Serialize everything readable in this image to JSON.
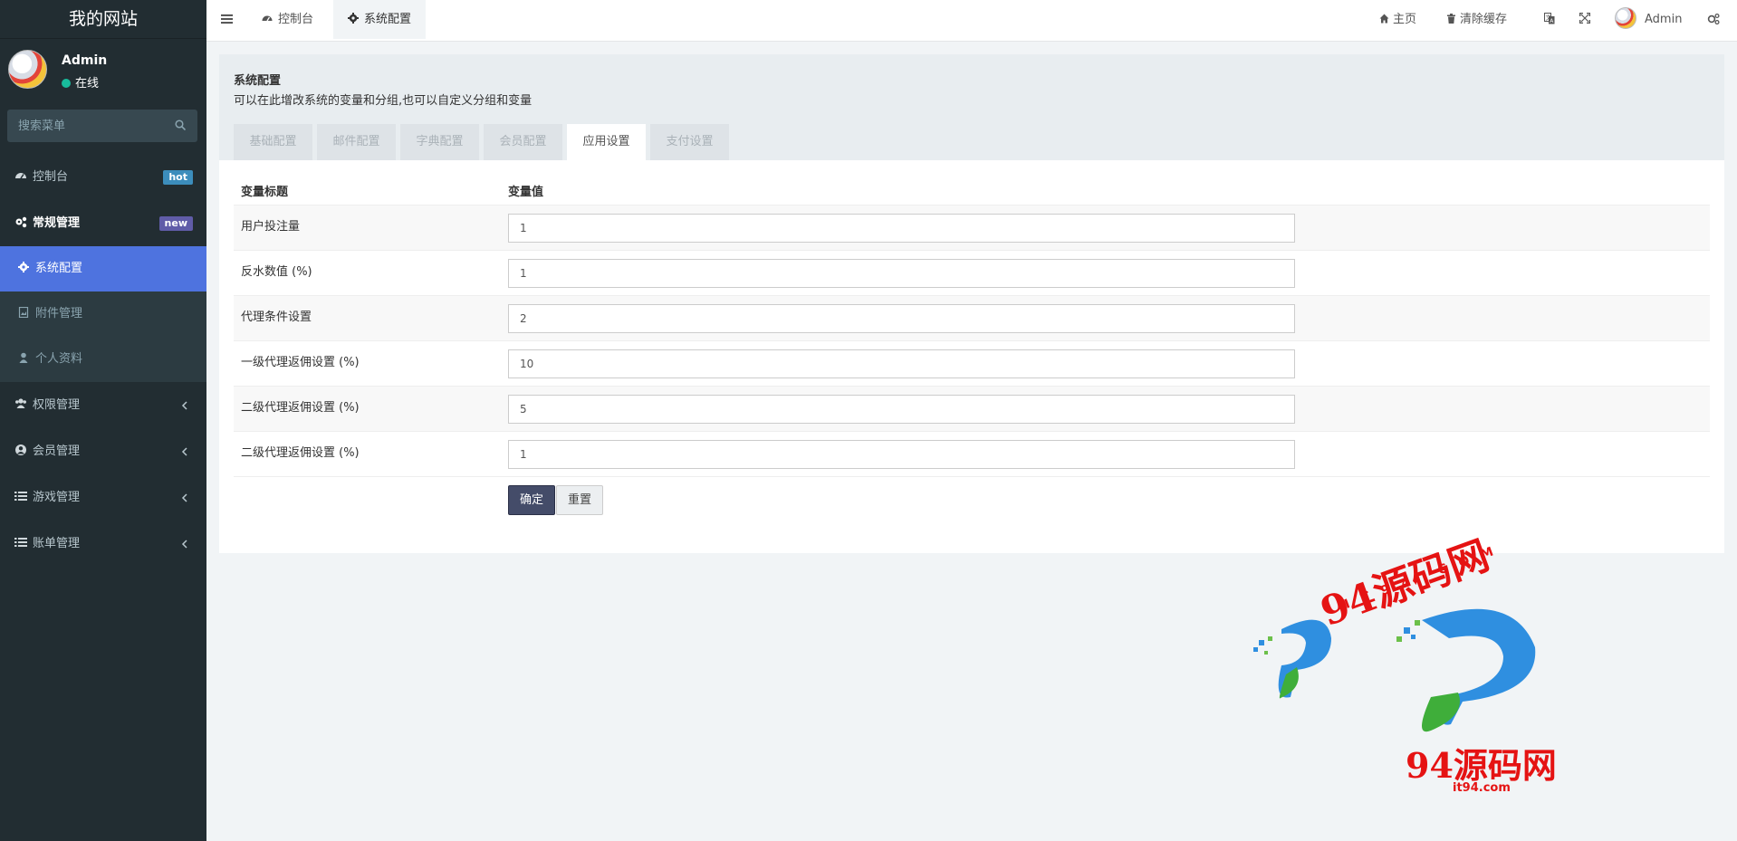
{
  "sidebar": {
    "site_title": "我的网站",
    "user": {
      "name": "Admin",
      "status": "在线"
    },
    "search_placeholder": "搜索菜单",
    "items": [
      {
        "label": "控制台",
        "badge": "hot"
      },
      {
        "label": "常规管理",
        "badge": "new"
      },
      {
        "label": "系统配置"
      },
      {
        "label": "附件管理"
      },
      {
        "label": "个人资料"
      },
      {
        "label": "权限管理"
      },
      {
        "label": "会员管理"
      },
      {
        "label": "游戏管理"
      },
      {
        "label": "账单管理"
      }
    ]
  },
  "topnav": {
    "tabs": [
      {
        "label": "控制台"
      },
      {
        "label": "系统配置"
      }
    ],
    "home": "主页",
    "clear_cache": "清除缓存",
    "user": "Admin"
  },
  "panel": {
    "title": "系统配置",
    "description": "可以在此增改系统的变量和分组,也可以自定义分组和变量",
    "tabs": [
      "基础配置",
      "邮件配置",
      "字典配置",
      "会员配置",
      "应用设置",
      "支付设置"
    ],
    "active_tab": "应用设置",
    "columns": [
      "变量标题",
      "变量值"
    ],
    "rows": [
      {
        "label": "用户投注量",
        "value": "1"
      },
      {
        "label": "反水数值 (%)",
        "value": "1"
      },
      {
        "label": "代理条件设置",
        "value": "2"
      },
      {
        "label": "一级代理返佣设置 (%)",
        "value": "10"
      },
      {
        "label": "二级代理返佣设置 (%)",
        "value": "5"
      },
      {
        "label": "二级代理返佣设置 (%)",
        "value": "1"
      }
    ],
    "confirm": "确定",
    "reset": "重置"
  },
  "watermark": {
    "text": "94源码网",
    "domain_upper": "IT94.COM",
    "domain": "it94.com"
  },
  "colors": {
    "sidebar_bg": "#222d32",
    "active_menu": "#4e73df",
    "online": "#18bc9c",
    "badge_hot": "#3c8dbc",
    "badge_new": "#605ca8",
    "btn_primary": "#444c69",
    "watermark_red": "#e51313"
  }
}
